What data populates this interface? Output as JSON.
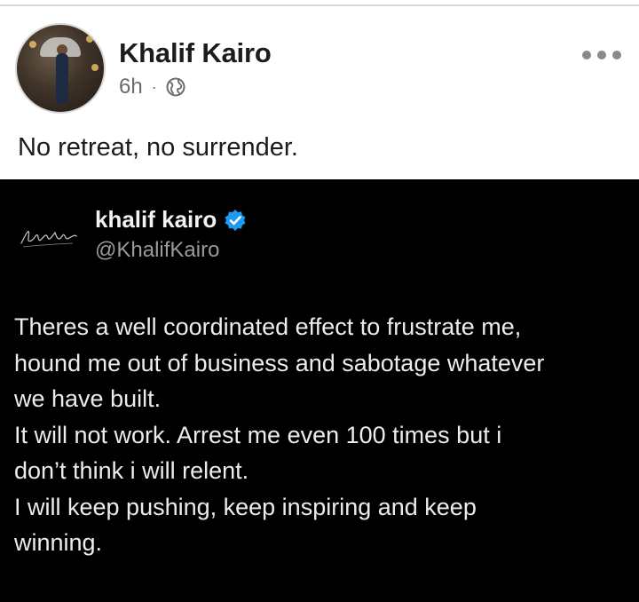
{
  "post": {
    "author_name": "Khalif Kairo",
    "time": "6h",
    "separator": "·",
    "privacy_icon": "globe-icon",
    "more_icon": "more-options-icon",
    "caption": "No retreat, no surrender."
  },
  "tweet": {
    "display_name": "khalif kairo",
    "handle": "@KhalifKairo",
    "verified_color": "#1d9bf0",
    "logo_text": "Khalif Kairo",
    "lines": [
      "Theres a well coordinated effect to frustrate me,",
      "hound me out of business and sabotage whatever",
      "we have built.",
      "It will not work. Arrest me even 100 times but i",
      "don’t think i will relent.",
      "I will keep pushing, keep inspiring and keep",
      "winning."
    ]
  },
  "colors": {
    "text_primary": "#1c1c1c",
    "text_secondary": "#6b6b6b",
    "tweet_background": "#000000"
  }
}
